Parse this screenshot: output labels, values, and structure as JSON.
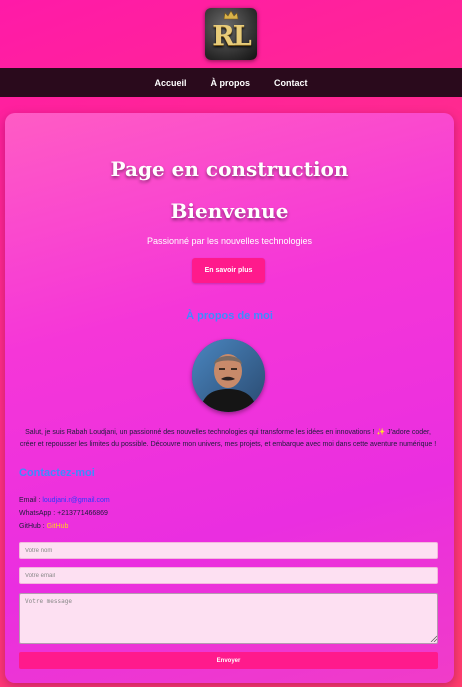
{
  "header": {
    "logo_text": "RL"
  },
  "nav": {
    "items": [
      "Accueil",
      "À propos",
      "Contact"
    ]
  },
  "hero": {
    "construction": "Page en construction",
    "welcome": "Bienvenue",
    "tagline": "Passionné par les nouvelles technologies",
    "cta_label": "En savoir plus"
  },
  "about": {
    "title": "À propos de moi",
    "bio": "Salut, je suis Rabah Loudjani, un passionné des nouvelles technologies qui transforme les idées en innovations ! ✨ J'adore coder, créer et repousser les limites du possible. Découvre mon univers, mes projets, et embarque avec moi dans cette aventure numérique !"
  },
  "contact": {
    "title": "Contactez-moi",
    "email_label": "Email : ",
    "email_value": "loudjani.r@gmail.com",
    "whatsapp_label": "WhatsApp : ",
    "whatsapp_value": "+213771466869",
    "github_label": "GitHub : ",
    "github_value": "GitHub"
  },
  "form": {
    "name_placeholder": "Votre nom",
    "email_placeholder": "Votre email",
    "message_placeholder": "Votre message",
    "submit_label": "Envoyer"
  },
  "colors": {
    "background": "#ff1aa8",
    "nav_background": "#2a0a1c",
    "button": "#ff1a8c",
    "section_title": "#3d8bff",
    "link": "#2a3cff",
    "github_link": "#ffd21a"
  }
}
